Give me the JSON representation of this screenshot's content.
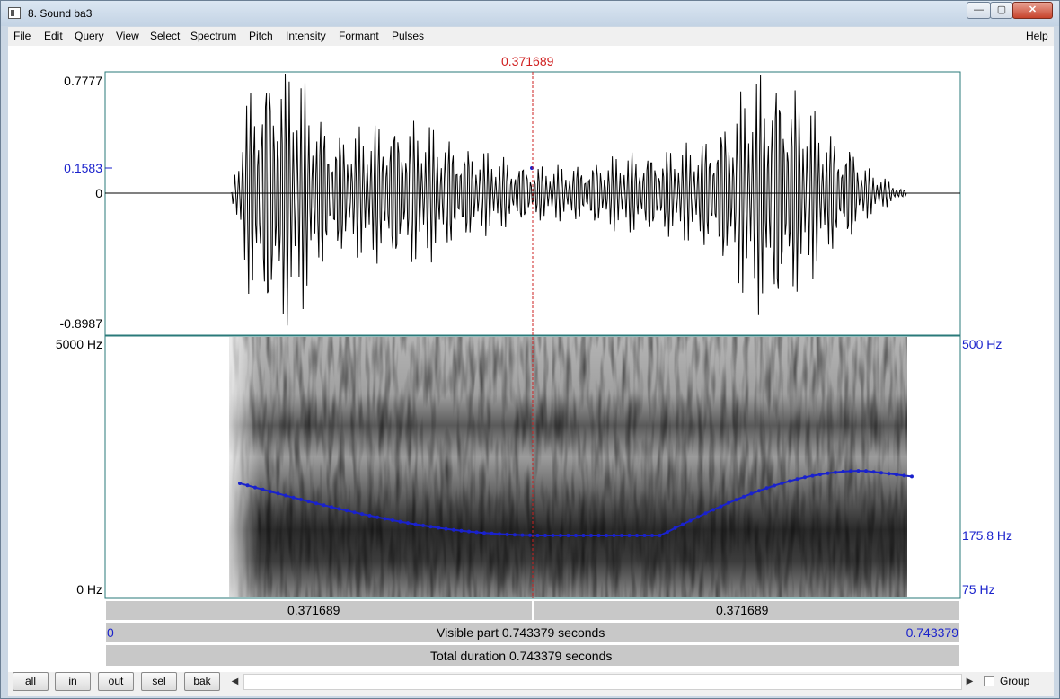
{
  "window": {
    "title": "8. Sound ba3",
    "min_symbol": "—",
    "max_symbol": "▢",
    "close_symbol": "✕"
  },
  "menu": [
    "File",
    "Edit",
    "Query",
    "View",
    "Select",
    "Spectrum",
    "Pitch",
    "Intensity",
    "Formant",
    "Pulses",
    "Help"
  ],
  "cursor": {
    "time": "0.371689"
  },
  "waveform": {
    "max": "0.7777",
    "cursor_value": "0.1583",
    "zero": "0",
    "min": "-0.8987"
  },
  "spectrogram": {
    "freq_top": "5000 Hz",
    "freq_bottom": "0 Hz"
  },
  "pitch": {
    "top": "500 Hz",
    "cursor_value": "175.8 Hz",
    "bottom": "75 Hz",
    "color": "#1a22cc"
  },
  "time_bars": {
    "left_segment": "0.371689",
    "right_segment": "0.371689",
    "visible_start": "0",
    "visible_label": "Visible part 0.743379 seconds",
    "visible_end": "0.743379",
    "total_label": "Total duration 0.743379 seconds"
  },
  "buttons": {
    "all": "all",
    "in": "in",
    "out": "out",
    "sel": "sel",
    "bak": "bak"
  },
  "scroll": {
    "left_arrow": "◀",
    "right_arrow": "▶"
  },
  "group_label": "Group"
}
